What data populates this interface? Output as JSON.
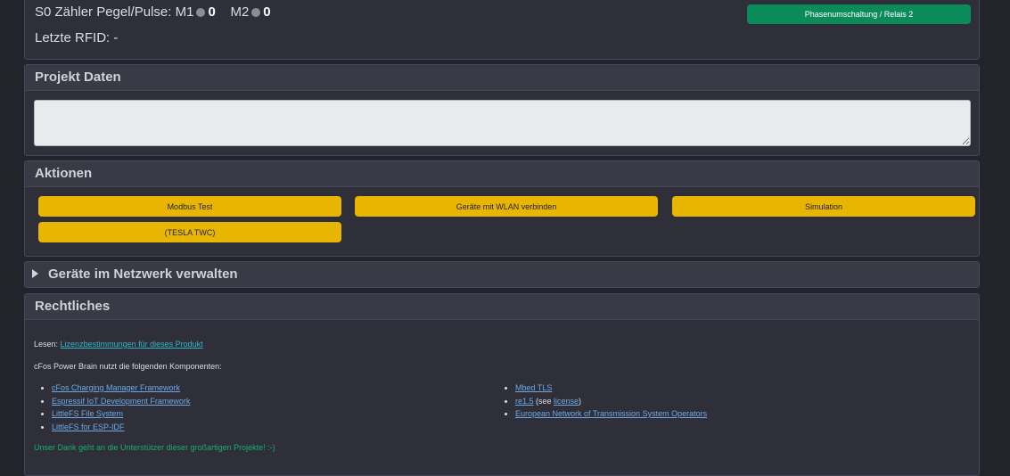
{
  "top": {
    "s0_label": "S0 Zähler Pegel/Pulse:",
    "m1_label": "M1",
    "m1_value": "0",
    "m2_label": "M2",
    "m2_value": "0",
    "rfid_label": "Letzte RFID:",
    "rfid_value": "-",
    "phase_button": "Phasenumschaltung / Relais 2"
  },
  "projekt": {
    "title": "Projekt Daten",
    "text_value": ""
  },
  "aktionen": {
    "title": "Aktionen",
    "buttons": [
      "Modbus Test",
      "Geräte mit WLAN verbinden",
      "Simulation",
      "(TESLA TWC)"
    ]
  },
  "geraete": {
    "title": "Geräte im Netzwerk verwalten"
  },
  "rechtliches": {
    "title": "Rechtliches",
    "lesen_prefix": "Lesen:",
    "license_link": "Lizenzbestimmungen für dieses Produkt",
    "components_intro": "cFos Power Brain nutzt die folgenden Komponenten:",
    "left_components": [
      "cFos Charging Manager Framework",
      "Espressif IoT Development Framework",
      "LittleFS File System",
      "LittleFS for ESP-IDF"
    ],
    "right_components": {
      "item1": "Mbed TLS",
      "item2_link": "re1.5",
      "item2_mid": " (see ",
      "item2_link2": "license",
      "item2_end": ")",
      "item3": "European Network of Transmission System Operators"
    },
    "thanks": "Unser Dank geht an die Unterstützer dieser großartigen Projekte! :-)"
  },
  "colors": {
    "accent_green": "#0b8a5a",
    "accent_yellow": "#e8b600",
    "link_blue": "#6fa8e6",
    "thanks_green": "#16b06a"
  }
}
